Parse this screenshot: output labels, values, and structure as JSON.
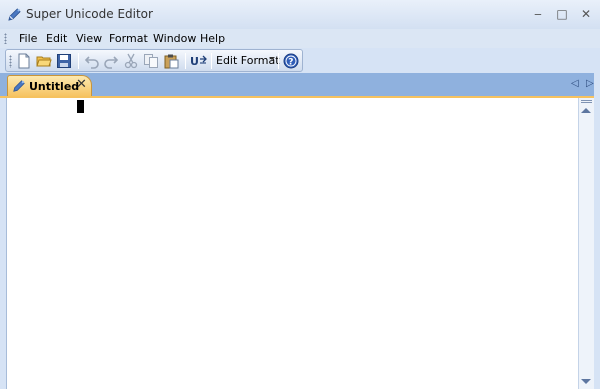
{
  "app": {
    "title": "Super Unicode Editor",
    "icon": "pen-icon"
  },
  "window_controls": {
    "minimize": "‒",
    "maximize": "□",
    "close": "✕"
  },
  "menu": {
    "items": [
      "File",
      "Edit",
      "View",
      "Format",
      "Window",
      "Help"
    ]
  },
  "toolbar": {
    "buttons": [
      "new-document-icon",
      "open-folder-icon",
      "save-icon",
      "undo-icon",
      "redo-icon",
      "cut-icon",
      "copy-icon",
      "paste-icon",
      "unicode-convert-icon",
      "help-icon"
    ],
    "edit_format_label": "Edit Format"
  },
  "tabs": [
    {
      "label": "Untitled",
      "close": "✕",
      "active": true
    }
  ],
  "tab_nav": {
    "left": "◁",
    "right": "▷"
  },
  "editor": {
    "content": ""
  },
  "colors": {
    "titlebar": "#dae5f4",
    "tabstrip": "#8fb1de",
    "active_tab": "#f6c25f",
    "editor_bg": "#ffffff"
  }
}
